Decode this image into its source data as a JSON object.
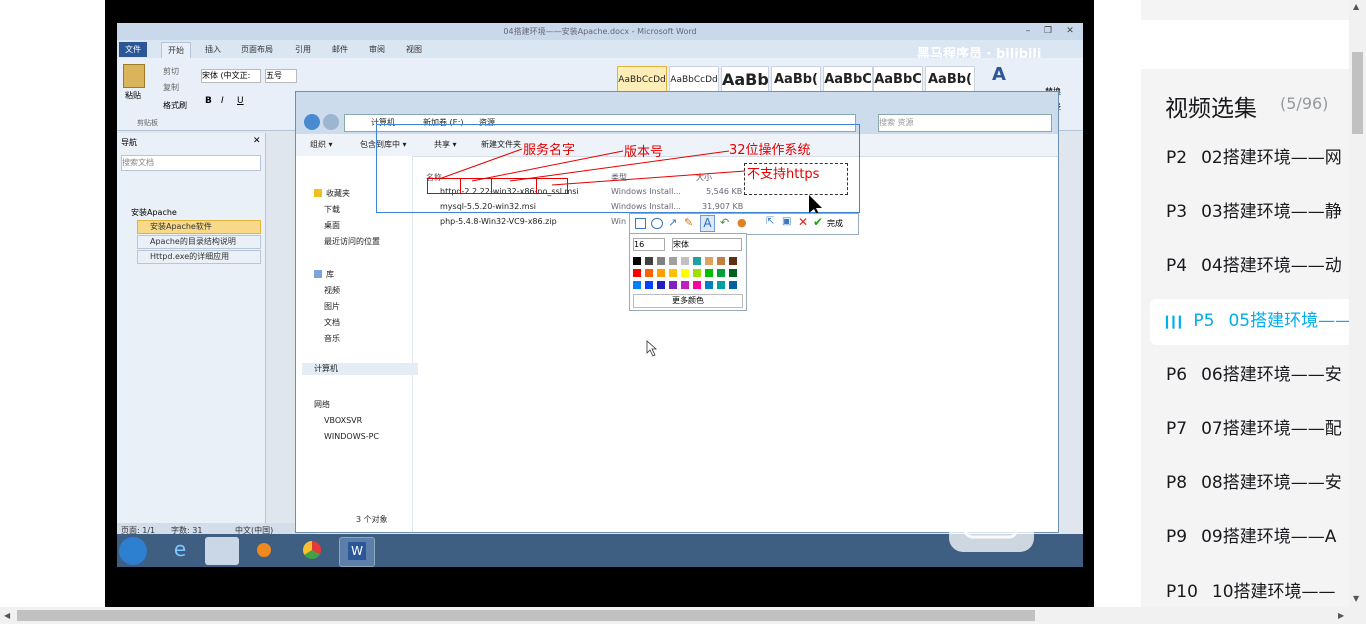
{
  "word": {
    "title": "04搭建环境——安装Apache.docx - Microsoft Word",
    "tabs": [
      "文件",
      "开始",
      "插入",
      "页面布局",
      "引用",
      "邮件",
      "审阅",
      "视图"
    ],
    "clipboard": {
      "paste": "粘贴",
      "cut": "剪切",
      "copy": "复制",
      "format_painter": "格式刷",
      "group": "剪贴板"
    },
    "font_name": "宋体 (中文正:",
    "font_size": "五号",
    "styles": [
      "AaBbCcDd",
      "AaBbCcDd",
      "AaBb",
      "AaBb(",
      "AaBbC",
      "AaBbC",
      "AaBb("
    ],
    "right_buttons": [
      "替换",
      "选择"
    ],
    "nav": {
      "title": "导航",
      "search_placeholder": "搜索文档",
      "items": [
        "安装Apache",
        "安装Apache软件",
        "Apache的目录结构说明",
        "Httpd.exe的详细应用"
      ]
    },
    "status": {
      "page": "页面: 1/1",
      "words": "字数: 31",
      "lang": "中文(中国)"
    }
  },
  "watermark": "黑马程序员 · bilibili",
  "explorer": {
    "breadcrumb": [
      "计算机",
      "新加卷 (E:)",
      "资源"
    ],
    "search_placeholder": "搜索 资源",
    "toolbar": [
      "组织 ▾",
      "包含到库中 ▾",
      "共享 ▾",
      "新建文件夹"
    ],
    "sidebar": {
      "favorites": "收藏夹",
      "fav_items": [
        "下载",
        "桌面",
        "最近访问的位置"
      ],
      "libraries": "库",
      "lib_items": [
        "视频",
        "图片",
        "文档",
        "音乐"
      ],
      "computer": "计算机",
      "network": "网络",
      "net_items": [
        "VBOXSVR",
        "WINDOWS-PC"
      ]
    },
    "columns": [
      "名称",
      "类型",
      "大小"
    ],
    "files": [
      {
        "name": "httpd-2.2.22-win32-x86-no_ssl.msi",
        "type": "Windows Install...",
        "size": "5,546 KB"
      },
      {
        "name": "mysql-5.5.20-win32.msi",
        "type": "Windows Install...",
        "size": "31,907 KB"
      },
      {
        "name": "php-5.4.8-Win32-VC9-x86.zip",
        "type": "Win",
        "size": ""
      }
    ],
    "status": "3 个对象"
  },
  "annotations": {
    "service_name": "服务名字",
    "version": "版本号",
    "os_bits": "32位操作系统",
    "no_https": "不支持https"
  },
  "annotate_toolbar": {
    "done": "完成",
    "font_size": "16",
    "font": "宋体",
    "more_colors": "更多颜色",
    "colors": [
      "#000000",
      "#404040",
      "#808080",
      "#a0a0a0",
      "#c0c0c0",
      "#20a0a0",
      "#e0a060",
      "#c08040",
      "#603010",
      "#ff0000",
      "#ff6000",
      "#ffa000",
      "#ffc000",
      "#ffff00",
      "#a0e000",
      "#00c000",
      "#00a040",
      "#006020",
      "#0080ff",
      "#0040ff",
      "#2020c0",
      "#8020c0",
      "#c020c0",
      "#ff00a0",
      "#0080c0",
      "#00a0a0",
      "#0060a0"
    ]
  },
  "playlist": {
    "title": "视频选集",
    "count": "(5/96)",
    "episodes": [
      {
        "num": "P2",
        "title": "02搭建环境——网"
      },
      {
        "num": "P3",
        "title": "03搭建环境——静"
      },
      {
        "num": "P4",
        "title": "04搭建环境——动"
      },
      {
        "num": "P5",
        "title": "05搭建环境——"
      },
      {
        "num": "P6",
        "title": "06搭建环境——安"
      },
      {
        "num": "P7",
        "title": "07搭建环境——配"
      },
      {
        "num": "P8",
        "title": "08搭建环境——安"
      },
      {
        "num": "P9",
        "title": "09搭建环境——A"
      },
      {
        "num": "P10",
        "title": "10搭建环境——"
      }
    ],
    "active_index": 3
  },
  "colors": {
    "accent": "#00aeec",
    "annotation": "#e60000"
  }
}
